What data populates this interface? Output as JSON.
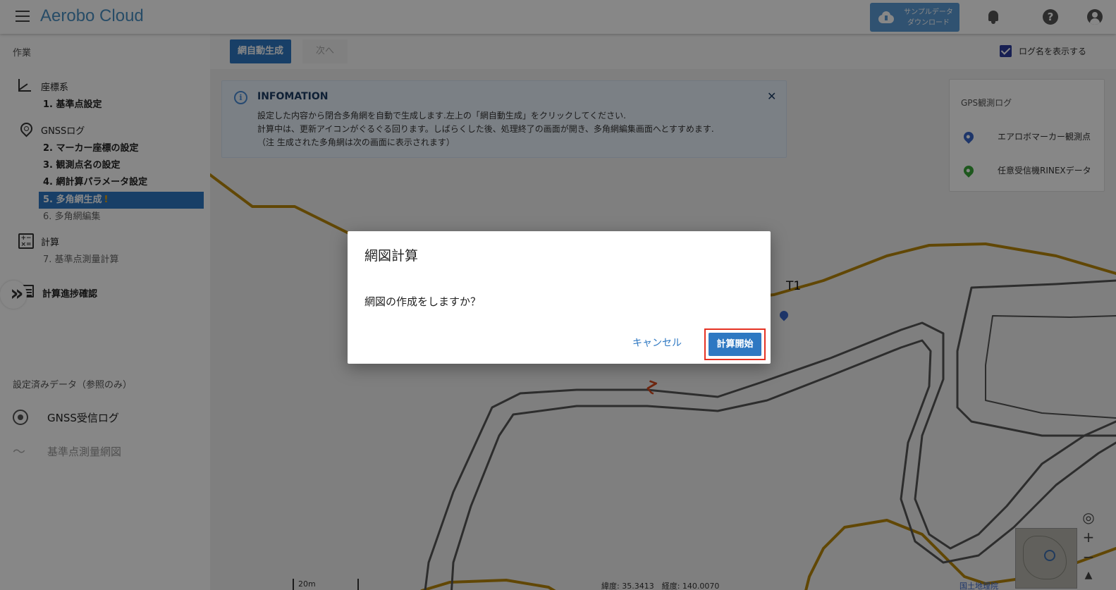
{
  "header": {
    "title": "Aerobo Cloud",
    "sample_button": {
      "line1": "サンプルデータ",
      "line2": "ダウンロード",
      "icon": "cloud-download-icon"
    },
    "help_glyph": "?"
  },
  "sidebar": {
    "work_label": "作業",
    "groups": [
      {
        "title": "座標系",
        "icon": "coordinate-axis-icon",
        "steps": [
          "1. 基準点設定"
        ]
      },
      {
        "title": "GNSSログ",
        "icon": "location-pin-icon",
        "steps": [
          "2. マーカー座標の設定",
          "3. 観測点名の設定",
          "4. 網計算パラメータ設定",
          "5. 多角網生成",
          "6. 多角網編集"
        ]
      },
      {
        "title": "計算",
        "icon": "calculator-icon",
        "steps": [
          "7. 基準点測量計算"
        ]
      },
      {
        "title": "計算進捗確認",
        "icon": "list-icon"
      }
    ],
    "active_step_warning": "!",
    "calc_icon_glyphs": "+−\n×=",
    "collapse_glyph": "»",
    "reference_label": "設定済みデータ（参照のみ）",
    "reference_items": [
      {
        "label": "GNSS受信ログ",
        "icon": "target-icon"
      },
      {
        "label": "基準点測量網図",
        "icon": "line-chart-icon"
      }
    ]
  },
  "toolbar": {
    "auto_generate_label": "網自動生成",
    "next_label": "次へ",
    "show_log_names_label": "ログ名を表示する",
    "show_log_names_checked": true
  },
  "info": {
    "title": "INFOMATION",
    "lines": [
      "設定した内容から閉合多角網を自動で生成します.左上の「網自動生成」をクリックしてください.",
      "計算中は、更新アイコンがぐるぐる回ります。しばらくした後、処理終了の画面が開き、多角網編集画面へとすすめます.",
      "（注 生成された多角網は次の画面に表示されます）"
    ],
    "close_glyph": "✕",
    "info_glyph": "i"
  },
  "gps_panel": {
    "title": "GPS観測ログ",
    "items": [
      {
        "label": "エアロボマーカー観測点",
        "color": "#3a67c9"
      },
      {
        "label": "任意受信機RINEXデータ",
        "color": "#3aa63a"
      }
    ]
  },
  "map": {
    "point_label": "T1",
    "scale_label": "20m",
    "coords": "緯度: 35.3413　経度: 140.0070",
    "attribution": "国土地理院",
    "controls": {
      "locate": "◎",
      "zoom_in": "+",
      "zoom_out": "−",
      "north": "▲"
    },
    "marker_glyph": "Ɀ"
  },
  "dialog": {
    "title": "網図計算",
    "message": "網図の作成をしますか？",
    "cancel_label": "キャンセル",
    "start_label": "計算開始"
  },
  "colors": {
    "brand": "#4a90c2",
    "primary": "#2e78c2",
    "highlight": "#e53223",
    "road": "#b8860b"
  }
}
